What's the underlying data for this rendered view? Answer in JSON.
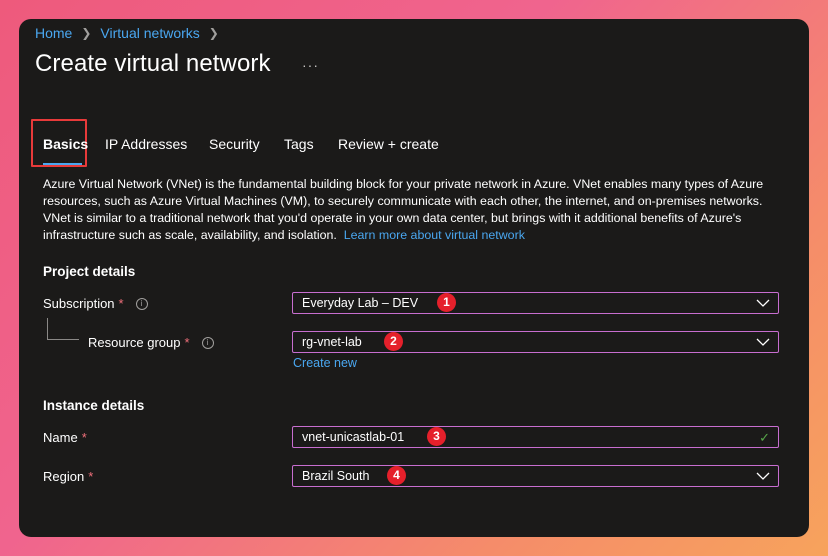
{
  "breadcrumb": {
    "home": "Home",
    "parent": "Virtual networks"
  },
  "page": {
    "title": "Create virtual network",
    "more": "···"
  },
  "tabs": [
    {
      "label": "Basics",
      "active": true
    },
    {
      "label": "IP Addresses"
    },
    {
      "label": "Security"
    },
    {
      "label": "Tags"
    },
    {
      "label": "Review + create"
    }
  ],
  "description": {
    "text": "Azure Virtual Network (VNet) is the fundamental building block for your private network in Azure. VNet enables many types of Azure resources, such as Azure Virtual Machines (VM), to securely communicate with each other, the internet, and on-premises networks. VNet is similar to a traditional network that you'd operate in your own data center, but brings with it additional benefits of Azure's infrastructure such as scale, availability, and isolation.",
    "link": "Learn more about virtual network"
  },
  "project": {
    "title": "Project details",
    "subscription": {
      "label": "Subscription",
      "required": "*",
      "value": "Everyday Lab – DEV",
      "badge": "1"
    },
    "resource_group": {
      "label": "Resource group",
      "required": "*",
      "value": "rg-vnet-lab",
      "badge": "2",
      "create_new": "Create new"
    }
  },
  "instance": {
    "title": "Instance details",
    "name": {
      "label": "Name",
      "required": "*",
      "value": "vnet-unicastlab-01",
      "badge": "3"
    },
    "region": {
      "label": "Region",
      "required": "*",
      "value": "Brazil South",
      "badge": "4"
    }
  },
  "colors": {
    "accent": "#4aa7f0",
    "field_border": "#c86ed0",
    "badge": "#e5202b",
    "highlight": "#e83a3a",
    "required": "#f1707b"
  }
}
